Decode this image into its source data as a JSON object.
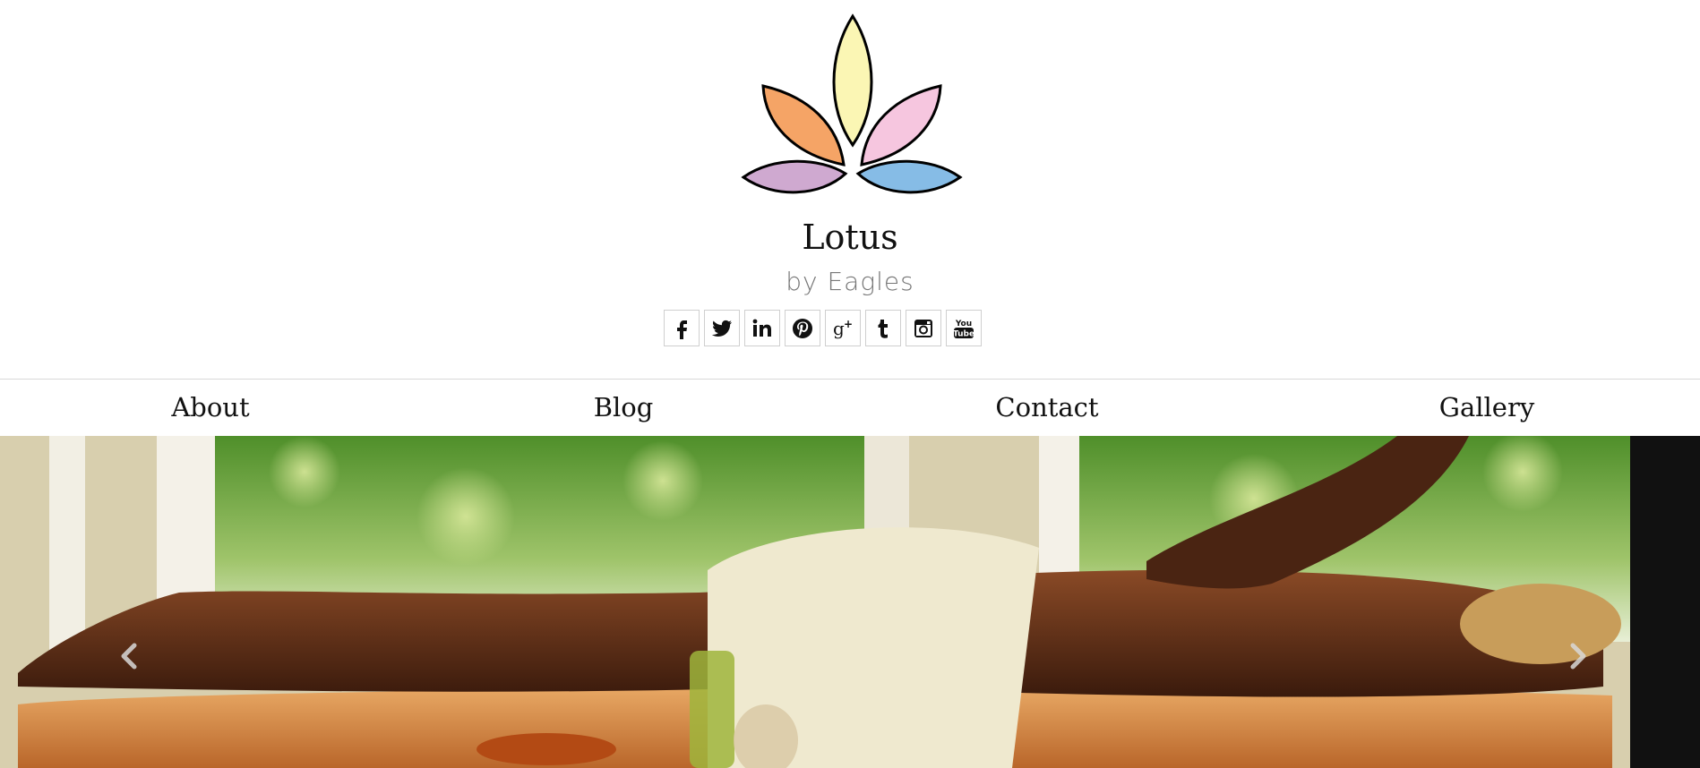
{
  "site": {
    "title": "Lotus",
    "subtitle": "by Eagles",
    "logo_icon": "lotus-logo-icon"
  },
  "social": [
    {
      "name": "facebook",
      "icon": "facebook-icon"
    },
    {
      "name": "twitter",
      "icon": "twitter-icon"
    },
    {
      "name": "linkedin",
      "icon": "linkedin-icon"
    },
    {
      "name": "pinterest",
      "icon": "pinterest-icon"
    },
    {
      "name": "google-plus",
      "icon": "google-plus-icon"
    },
    {
      "name": "tumblr",
      "icon": "tumblr-icon"
    },
    {
      "name": "instagram",
      "icon": "instagram-icon"
    },
    {
      "name": "youtube",
      "icon": "youtube-icon",
      "label_top": "You",
      "label_bottom": "Tube"
    }
  ],
  "nav": {
    "items": [
      {
        "label": "About"
      },
      {
        "label": "Blog"
      },
      {
        "label": "Contact"
      },
      {
        "label": "Gallery"
      }
    ]
  },
  "carousel": {
    "prev_icon": "chevron-left-icon",
    "next_icon": "chevron-right-icon"
  },
  "colors": {
    "petal_center": "#fbf6b4",
    "petal_left": "#f5a466",
    "petal_right": "#f6c6df",
    "petal_bottom_left": "#cfa9d0",
    "petal_bottom_right": "#86bce6",
    "text": "#111111",
    "subtitle": "#777777",
    "border": "#cfcfcf"
  }
}
